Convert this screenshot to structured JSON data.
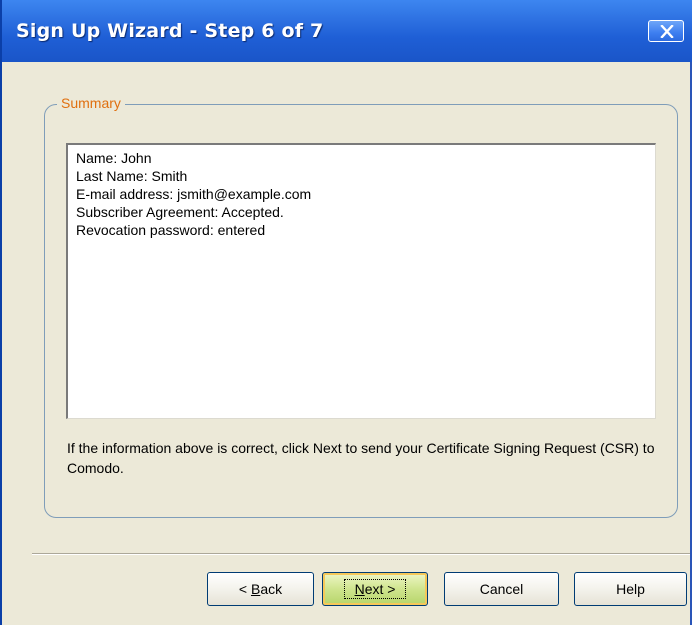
{
  "window": {
    "title": "Sign Up Wizard - Step 6 of 7"
  },
  "icons": {
    "close": "close-icon"
  },
  "summary": {
    "legend": "Summary",
    "lines": [
      "Name: John",
      "Last Name: Smith",
      "E-mail address: jsmith@example.com",
      "Subscriber Agreement: Accepted.",
      "Revocation password: entered"
    ],
    "info": "If the information above is correct, click Next to send your Certificate Signing Request (CSR) to Comodo."
  },
  "buttons": {
    "back_prefix": "< ",
    "back_mnemonic": "B",
    "back_rest": "ack",
    "next_mnemonic": "N",
    "next_rest": "ext >",
    "cancel": "Cancel",
    "help": "Help"
  },
  "colors": {
    "title_bar": "#1f5fd6",
    "legend": "#e07010",
    "dialog_bg": "#ece9d8"
  }
}
